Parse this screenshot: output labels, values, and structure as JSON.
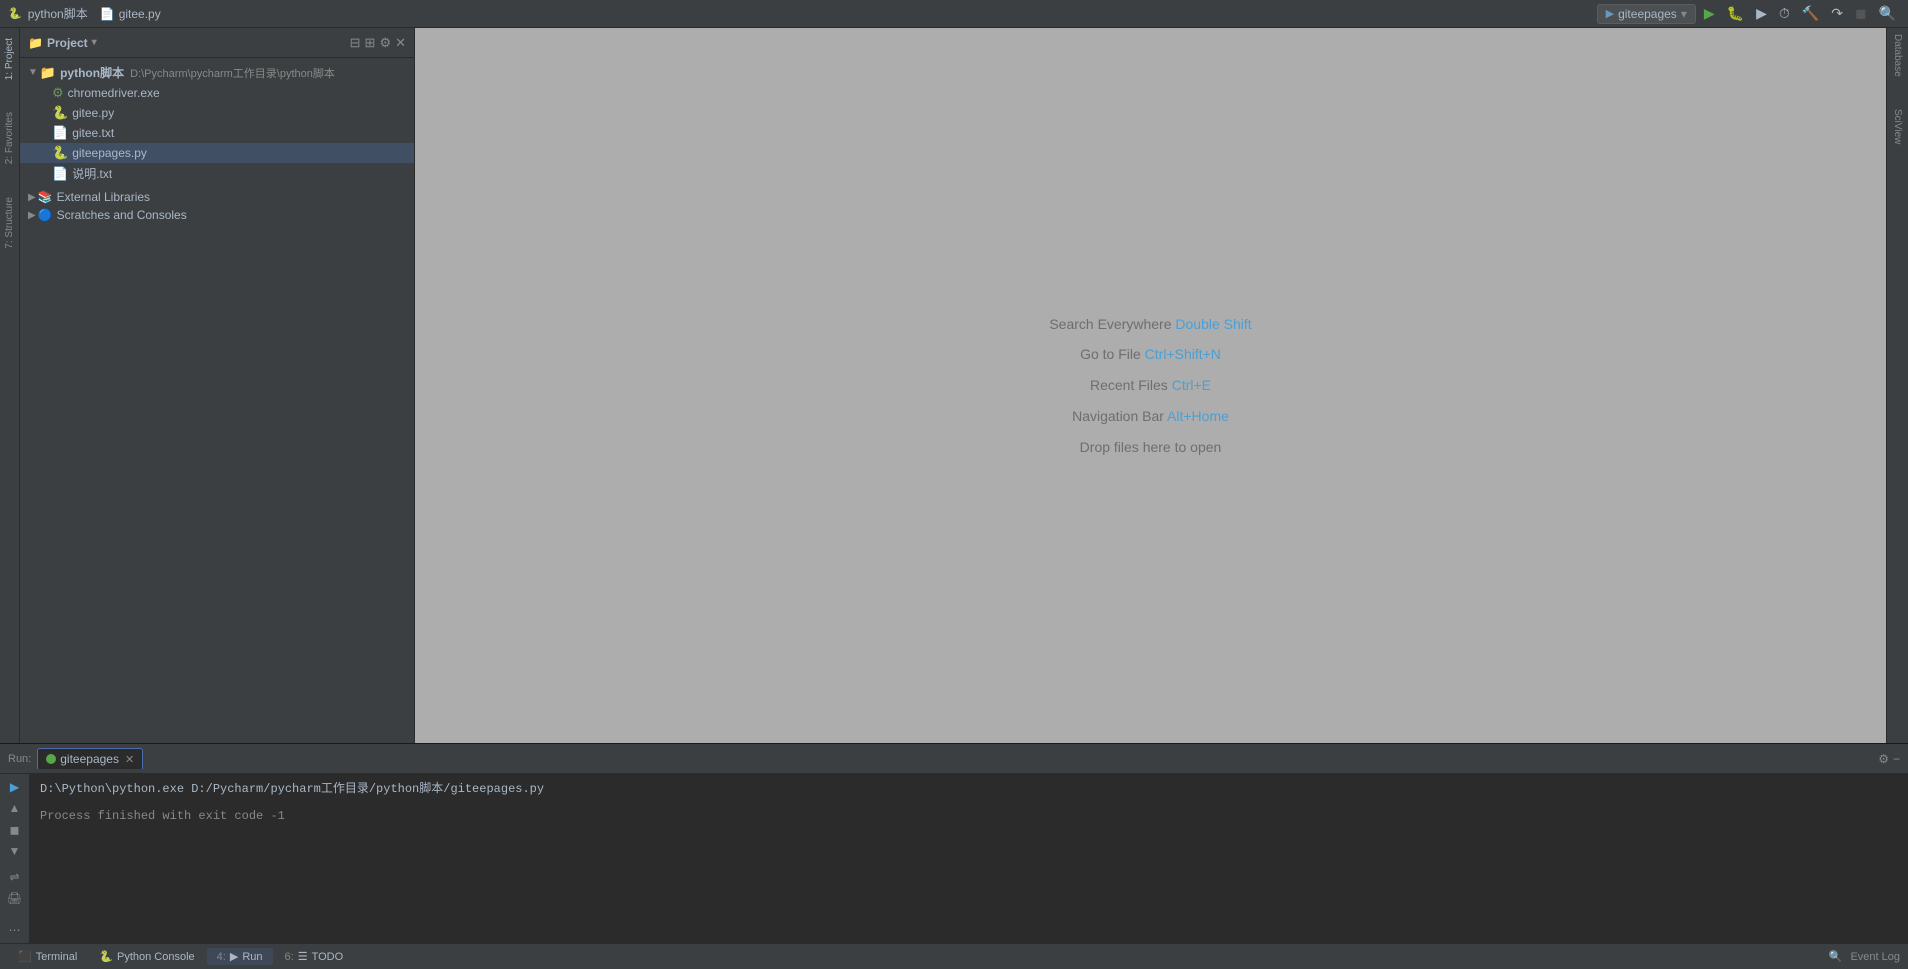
{
  "titlebar": {
    "project_tab": "python脚本",
    "file_tab": "gitee.py",
    "run_config": "giteepages",
    "dropdown_arrow": "▾"
  },
  "toolbar": {
    "run_btn": "▶",
    "debug_btn": "🐛",
    "run_coverage": "▶",
    "profile_btn": "⏱",
    "build_btn": "🔨",
    "step_over": "↷",
    "stop_btn": "◼",
    "search_btn": "🔍"
  },
  "project_panel": {
    "title": "Project",
    "root_name": "python脚本",
    "root_path": "D:\\Pycharm\\pycharm工作目录\\python脚本",
    "items": [
      {
        "name": "chromedriver.exe",
        "type": "exe",
        "indent": 2
      },
      {
        "name": "gitee.py",
        "type": "py",
        "indent": 2
      },
      {
        "name": "gitee.txt",
        "type": "txt",
        "indent": 2
      },
      {
        "name": "giteepages.py",
        "type": "py",
        "indent": 2,
        "selected": true
      },
      {
        "name": "说明.txt",
        "type": "txt",
        "indent": 2
      }
    ],
    "external_libraries": "External Libraries",
    "scratches": "Scratches and Consoles"
  },
  "editor": {
    "hint1_prefix": "Search Everywhere ",
    "hint1_shortcut": "Double Shift",
    "hint2_prefix": "Go to File ",
    "hint2_shortcut": "Ctrl+Shift+N",
    "hint3_prefix": "Recent Files ",
    "hint3_shortcut": "Ctrl+E",
    "hint4_prefix": "Navigation Bar ",
    "hint4_shortcut": "Alt+Home",
    "hint5": "Drop files here to open"
  },
  "run_panel": {
    "run_label": "Run:",
    "tab_name": "giteepages",
    "output_line1": "D:\\Python\\python.exe D:/Pycharm/pycharm工作目录/python脚本/giteepages.py",
    "output_line2": "",
    "output_line3": "Process finished with exit code -1"
  },
  "bottom_tabs": [
    {
      "id": "terminal",
      "label": "Terminal",
      "icon": "⬛"
    },
    {
      "id": "python-console",
      "label": "Python Console",
      "icon": "🐍",
      "active": false
    },
    {
      "id": "run",
      "label": "4: Run",
      "icon": "▶",
      "active": true
    },
    {
      "id": "todo",
      "label": "6: TODO",
      "icon": "☰"
    }
  ],
  "bottom_right": {
    "event_log": "Event Log",
    "search_icon": "🔍"
  },
  "right_strip": {
    "database": "Database",
    "sciview": "SciView"
  },
  "left_tabs": {
    "project": "1: Project",
    "favorites": "2: Favorites",
    "structure": "7: Structure"
  }
}
